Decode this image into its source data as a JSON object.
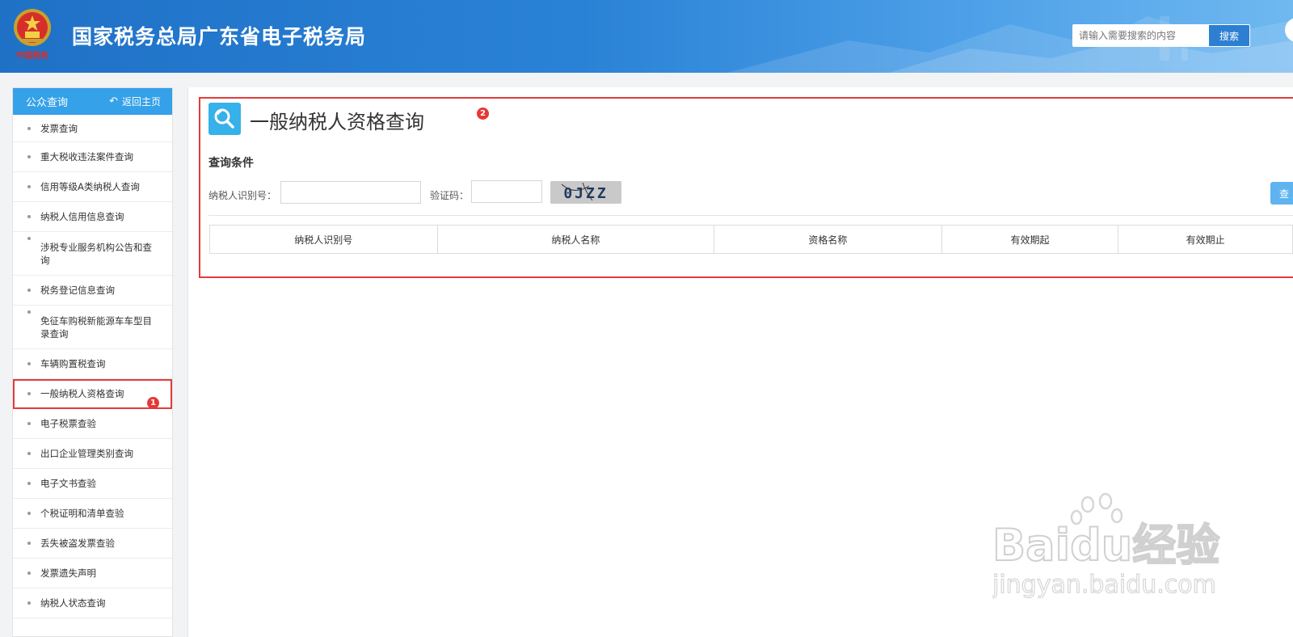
{
  "header": {
    "site_title": "国家税务总局广东省电子税务局",
    "emblem_caption": "中国税务",
    "search_placeholder": "请输入需要搜索的内容",
    "search_button": "搜索"
  },
  "sidebar": {
    "title": "公众查询",
    "back_label": "返回主页",
    "active_index": 8,
    "items": [
      {
        "label": "发票查询"
      },
      {
        "label": "重大税收违法案件查询"
      },
      {
        "label": "信用等级A类纳税人查询"
      },
      {
        "label": "纳税人信用信息查询"
      },
      {
        "label": "涉税专业服务机构公告和查询"
      },
      {
        "label": "税务登记信息查询"
      },
      {
        "label": "免征车购税新能源车车型目录查询"
      },
      {
        "label": "车辆购置税查询"
      },
      {
        "label": "一般纳税人资格查询"
      },
      {
        "label": "电子税票查验"
      },
      {
        "label": "出口企业管理类别查询"
      },
      {
        "label": "电子文书查验"
      },
      {
        "label": "个税证明和清单查验"
      },
      {
        "label": "丢失被盗发票查验"
      },
      {
        "label": "发票遗失声明"
      },
      {
        "label": "纳税人状态查询"
      }
    ]
  },
  "annotations": {
    "badge1": "1",
    "badge2": "2"
  },
  "main": {
    "title": "一般纳税人资格查询",
    "conditions_title": "查询条件",
    "taxpayer_id_label": "纳税人识别号：",
    "taxpayer_id_value": "",
    "captcha_label": "验证码：",
    "captcha_value": "",
    "captcha_text": "0JZZ",
    "query_button": "查",
    "table_headers": [
      "纳税人识别号",
      "纳税人名称",
      "资格名称",
      "有效期起",
      "有效期止"
    ]
  },
  "watermark": {
    "brand": "Baidu经验",
    "url": "jingyan.baidu.com"
  },
  "colors": {
    "header_blue": "#2a82d6",
    "sidebar_head": "#35a1e8",
    "highlight_red": "#e33b3b",
    "query_icon": "#36b1e9"
  }
}
